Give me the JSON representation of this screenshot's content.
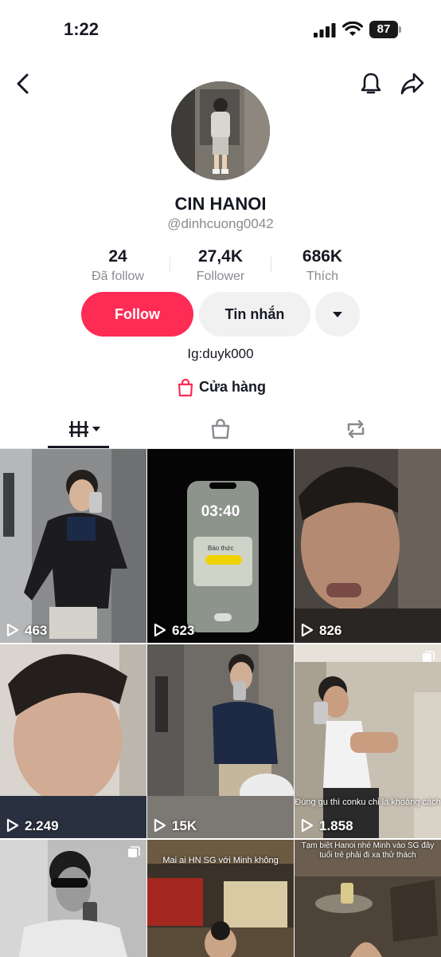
{
  "status_bar": {
    "time": "1:22",
    "battery": "87"
  },
  "profile": {
    "name": "CIN HANOI",
    "handle": "@dinhcuong0042",
    "stats": [
      {
        "value": "24",
        "label": "Đã follow"
      },
      {
        "value": "27,4K",
        "label": "Follower"
      },
      {
        "value": "686K",
        "label": "Thích"
      }
    ],
    "follow_label": "Follow",
    "message_label": "Tin nhắn",
    "bio": "Ig:duyk000",
    "shop_label": "Cửa hàng"
  },
  "icons": {
    "back": "back-arrow-icon",
    "bell": "bell-icon",
    "share": "share-icon",
    "more": "chevron-down-icon",
    "shop": "shopping-bag-icon",
    "tab_videos": "grid-icon",
    "tab_shop": "shopping-bag-icon",
    "tab_repost": "repost-icon"
  },
  "colors": {
    "accent": "#fe2c55",
    "secondary_button": "#f1f1f2",
    "muted_text": "#8a8b91"
  },
  "videos": [
    {
      "views": "463",
      "caption": ""
    },
    {
      "views": "623",
      "caption": ""
    },
    {
      "views": "826",
      "caption": ""
    },
    {
      "views": "2.249",
      "caption": ""
    },
    {
      "views": "15K",
      "caption": ""
    },
    {
      "views": "1.858",
      "caption": "Đúng gu thì conku chỉ là khoảng cách"
    },
    {
      "views": "",
      "caption": ""
    },
    {
      "views": "",
      "caption": "Mai ai HN SG với Minh không"
    },
    {
      "views": "",
      "caption": "Tạm biệt Hanoi nhé Minh vào SG đây tuổi trẻ phải đi xa thử thách"
    }
  ],
  "phone_screen": {
    "time": "03:40",
    "alarm_label": "Báo thức"
  }
}
